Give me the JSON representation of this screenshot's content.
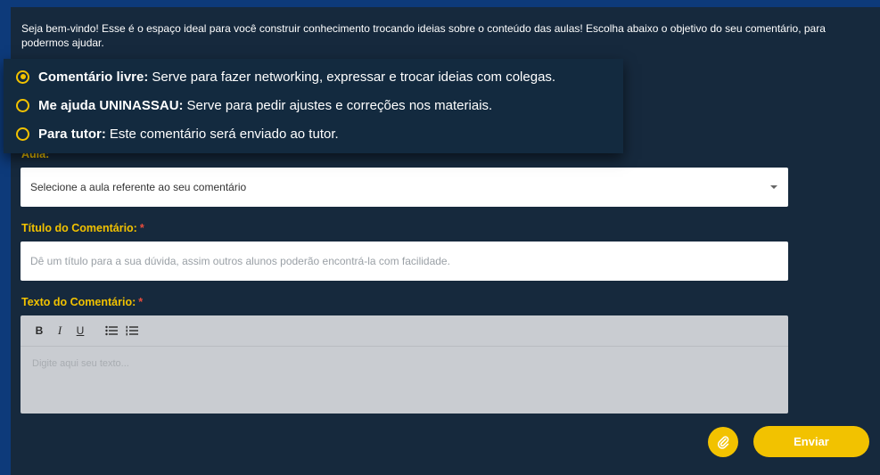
{
  "intro": "Seja bem-vindo! Esse é o espaço ideal para você construir conhecimento trocando ideias sobre o conteúdo das aulas! Escolha abaixo o objetivo do seu comentário, para podermos ajudar.",
  "options": [
    {
      "title": "Comentário livre:",
      "desc": "Serve para fazer networking, expressar e trocar ideias com colegas.",
      "selected": true
    },
    {
      "title": "Me ajuda UNINASSAU:",
      "desc": "Serve para pedir ajustes e correções nos materiais.",
      "selected": false
    },
    {
      "title": "Para tutor:",
      "desc": "Este comentário será enviado ao tutor.",
      "selected": false
    }
  ],
  "aula": {
    "label": "Aula:",
    "value": "Selecione a aula referente ao seu comentário"
  },
  "titulo": {
    "label": "Título do Comentário:",
    "required_mark": "*",
    "placeholder": "Dê um título para a sua dúvida, assim outros alunos poderão encontrá-la com facilidade."
  },
  "texto": {
    "label": "Texto do Comentário:",
    "required_mark": "*",
    "placeholder": "Digite aqui seu texto...",
    "toolbar": {
      "bold": "B",
      "italic": "I",
      "underline": "U"
    }
  },
  "actions": {
    "send": "Enviar"
  },
  "colors": {
    "accent": "#f2c200",
    "background": "#16293d",
    "frame": "#0d3a7a"
  }
}
